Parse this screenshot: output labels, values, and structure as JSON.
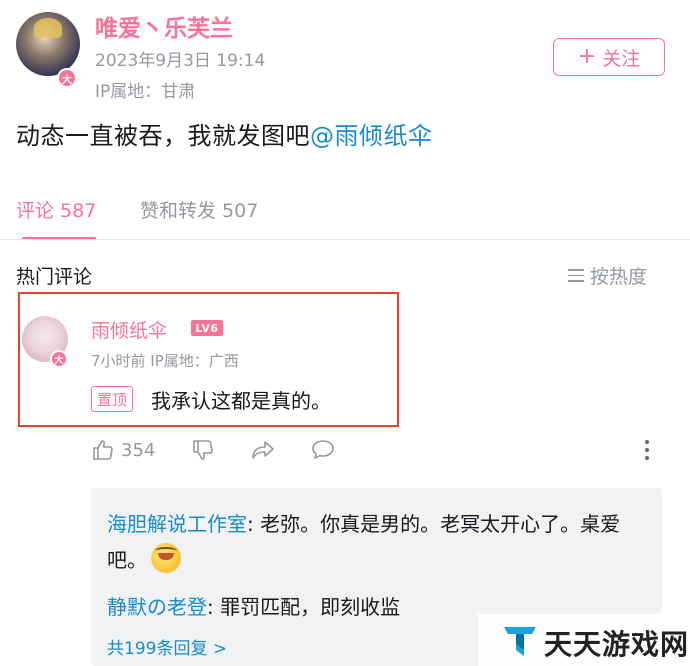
{
  "post": {
    "author": "唯爱丶乐芙兰",
    "avatar_badge": "大",
    "time": "2023年9月3日 19:14",
    "ip": "IP属地：甘肃",
    "follow_label": "关注",
    "text": "动态一直被吞，我就发图吧",
    "mention": "@雨倾纸伞"
  },
  "tabs": {
    "comments": "评论 587",
    "likes_forwards": "赞和转发 507"
  },
  "comments_header": {
    "hot_label": "热门评论",
    "sort_label": "按热度"
  },
  "top_comment": {
    "author": "雨倾纸伞",
    "level": "LV6",
    "avatar_badge": "大",
    "meta": "7小时前  IP属地：广西",
    "pin_tag": "置顶",
    "text": "我承认这都是真的。",
    "like_count": "354"
  },
  "replies": {
    "items": [
      {
        "name": "海胆解说工作室",
        "text": ": 老弥。你真是男的。老冥太开心了。桌爱吧。"
      },
      {
        "name": "静默の老登",
        "text": ": 罪罚匹配，即刻收监"
      }
    ],
    "more_label": "共199条回复 >"
  },
  "watermark": {
    "text": "天天游戏网"
  },
  "colors": {
    "accent": "#fb7299",
    "link": "#178bcf",
    "highlight": "#e8412d"
  }
}
